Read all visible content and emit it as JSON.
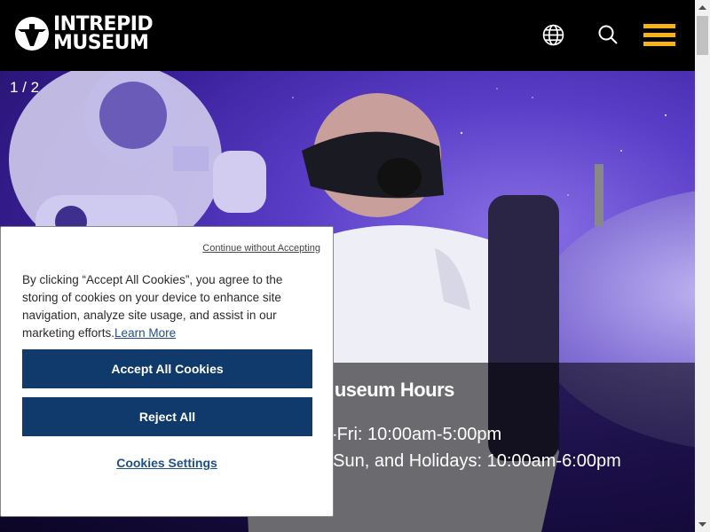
{
  "header": {
    "logo_line1": "INTREPID",
    "logo_line2": "MUSEUM",
    "icons": [
      "globe-icon",
      "search-icon",
      "hamburger-menu-icon"
    ],
    "accent_color": "#f6b21b"
  },
  "hero": {
    "slide_counter": "1 / 2",
    "hours_title": "Museum Hours",
    "hours_weekday": "Mon-Fri: 10:00am-5:00pm",
    "hours_weekend": "Sat, Sun, and Holidays: 10:00am-6:00pm"
  },
  "cookie_banner": {
    "continue_without_accepting": "Continue without Accepting",
    "body_text": "By clicking “Accept All Cookies”, you agree to the storing of cookies on your device to enhance site navigation, analyze site usage, and assist in our marketing efforts.",
    "learn_more": "Learn More",
    "accept_all": "Accept All Cookies",
    "reject_all": "Reject All",
    "settings": "Cookies Settings",
    "button_color": "#0f3a6b"
  }
}
